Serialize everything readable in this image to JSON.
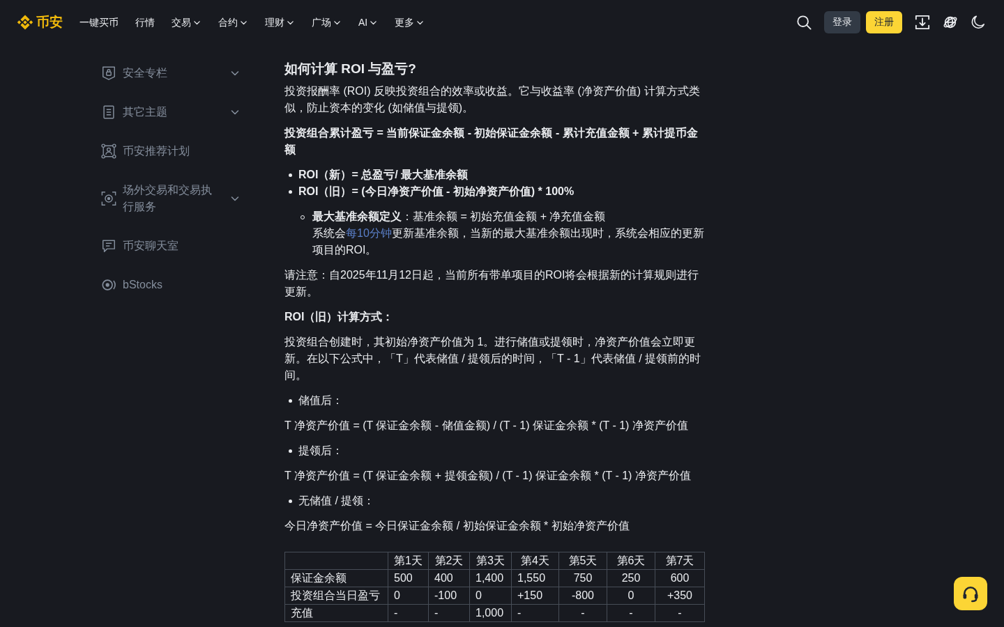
{
  "header": {
    "brand": "币安",
    "nav": [
      {
        "label": "一键买币",
        "kind": "link"
      },
      {
        "label": "行情",
        "kind": "link"
      },
      {
        "label": "交易",
        "kind": "dropdown"
      },
      {
        "label": "合约",
        "kind": "dropdown"
      },
      {
        "label": "理财",
        "kind": "dropdown"
      },
      {
        "label": "广场",
        "kind": "dropdown"
      },
      {
        "label": "AI",
        "kind": "dropdown"
      },
      {
        "label": "更多",
        "kind": "dropdown"
      }
    ],
    "buttons": [
      {
        "label": "登录",
        "kind": "secondary"
      },
      {
        "label": "注册",
        "kind": "primary"
      }
    ]
  },
  "sidebar": {
    "items": [
      {
        "label": "安全专栏",
        "kind": "group"
      },
      {
        "label": "其它主题",
        "kind": "group"
      },
      {
        "label": "币安推荐计划",
        "kind": "page"
      },
      {
        "label": "场外交易和交易执行服务",
        "kind": "group"
      },
      {
        "label": "币安聊天室",
        "kind": "page"
      },
      {
        "label": "bStocks",
        "kind": "page"
      }
    ]
  },
  "article": {
    "blocks": [
      {
        "kind": "heading",
        "text": "如何计算 ROI 与盈亏?"
      },
      {
        "kind": "paragraph",
        "text": "投资报酬率 (ROI) 反映投资组合的效率或收益。它与收益率 (净资产价值) 计算方式类似，防止资本的变化 (如储值与提领)。"
      },
      {
        "kind": "formula",
        "text": "投资组合累计盈亏 = 当前保证金余额 - 初始保证金余额 - 累计充值金额 + 累计提币金额"
      },
      {
        "kind": "list",
        "items": [
          "ROI（新）= 总盈亏/ 最大基准余额",
          "ROI（旧）= (今日净资产价值 - 初始净资产价值) * 100%"
        ]
      },
      {
        "kind": "sublist",
        "items": [
          {
            "definition": "**最大基准余额定义**：基准余额 = 初始充值金额 + 净充值金额",
            "before_link": "系统会",
            "link": "每10分钟",
            "after_link": "更新基准余额，当新的最大基准余额出现时，系统会相应的更新项目的ROI。"
          }
        ]
      },
      {
        "kind": "paragraph",
        "text": "请注意：自2025年11月12日起，当前所有带单项目的ROI将会根据新的计算规则进行更新。"
      },
      {
        "kind": "subheading",
        "text": "ROI（旧）计算方式："
      },
      {
        "kind": "paragraph",
        "text": "投资组合创建时，其初始净资产价值为 1。进行储值或提领时，净资产价值会立即更新。在以下公式中，「T」代表储值 / 提领后的时间，「T - 1」代表储值 / 提领前的时间。"
      },
      {
        "kind": "bullet",
        "text": "储值后："
      },
      {
        "kind": "paragraph",
        "text": "T 净资产价值 = (T 保证金余额 - 储值金额) / (T - 1) 保证金余额 * (T - 1) 净资产价值"
      },
      {
        "kind": "bullet",
        "text": "提领后："
      },
      {
        "kind": "paragraph",
        "text": "T 净资产价值 = (T 保证金余额 + 提领金额) / (T - 1) 保证金余额 * (T - 1) 净资产价值"
      },
      {
        "kind": "bullet",
        "text": "无储值 / 提领："
      },
      {
        "kind": "paragraph",
        "text": "今日净资产价值 = 今日保证金余额 / 初始保证金余额 * 初始净资产价值"
      },
      {
        "kind": "table",
        "columns": [
          "第1天",
          "第2天",
          "第3天",
          "第4天",
          "第5天",
          "第6天",
          "第7天"
        ],
        "rows": [
          {
            "label": "保证金余额",
            "cells": [
              "500",
              "400",
              "1,400",
              "1,550",
              "750",
              "250",
              "600"
            ]
          },
          {
            "label": "投资组合当日盈亏",
            "cells": [
              "0",
              "-100",
              "0",
              "+150",
              "-800",
              "0",
              "+350"
            ]
          },
          {
            "label": "充值",
            "cells": [
              "-",
              "-",
              "1,000",
              "-",
              "-",
              "-",
              "-"
            ]
          }
        ]
      }
    ]
  }
}
